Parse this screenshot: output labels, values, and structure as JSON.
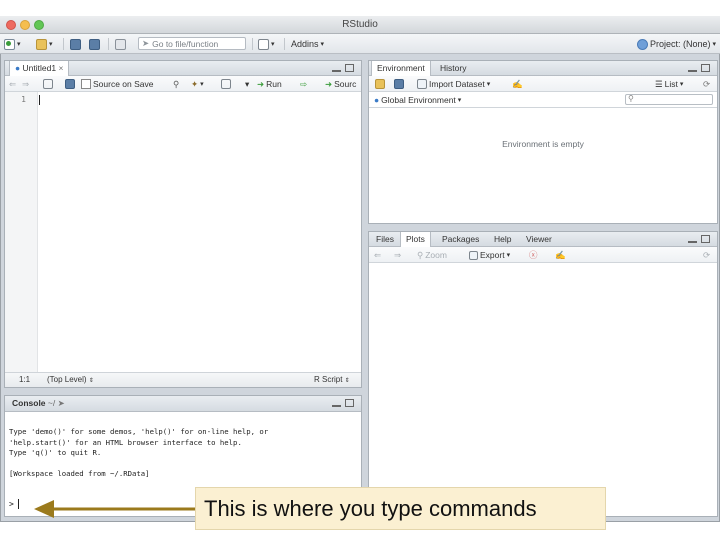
{
  "app": {
    "title": "RStudio"
  },
  "toolbar": {
    "goto_placeholder": "Go to file/function",
    "addins_label": "Addins",
    "project_label": "Project: (None)"
  },
  "editor": {
    "tab_label": "Untitled1",
    "source_on_save_label": "Source on Save",
    "run_label": "Run",
    "source_label": "Sourc",
    "line_number": "1",
    "status_position": "1:1",
    "status_scope": "(Top Level)",
    "status_filetype": "R Script"
  },
  "env": {
    "tabs": [
      "Environment",
      "History"
    ],
    "import_label": "Import Dataset",
    "list_label": "List",
    "global_env_label": "Global Environment",
    "empty_text": "Environment is empty"
  },
  "files": {
    "tabs": [
      "Files",
      "Plots",
      "Packages",
      "Help",
      "Viewer"
    ],
    "zoom_label": "Zoom",
    "export_label": "Export"
  },
  "console": {
    "tab_label": "Console",
    "path_label": "~/",
    "lines": [
      "Type 'demo()' for some demos, 'help()' for on-line help, or",
      "'help.start()' for an HTML browser interface to help.",
      "Type 'q()' to quit R.",
      "",
      "[Workspace loaded from ~/.RData]"
    ],
    "prompt": ">"
  },
  "annotation": {
    "text": "This is where you type commands",
    "arrow_color": "#9b7a1c"
  }
}
